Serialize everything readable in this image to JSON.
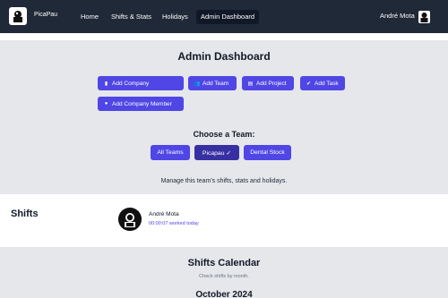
{
  "nav": {
    "brand": "PicaPau",
    "links": [
      {
        "label": "Home"
      },
      {
        "label": "Shifts & Stats"
      },
      {
        "label": "Holidays"
      },
      {
        "label": "Admin Dashboard"
      }
    ],
    "user_name": "André Mota"
  },
  "admin": {
    "title": "Admin Dashboard",
    "buttons": [
      {
        "label": "Add Company",
        "icon": "building-icon"
      },
      {
        "label": "Add Team",
        "icon": "team-icon"
      },
      {
        "label": "Add Project",
        "icon": "clipboard-icon"
      },
      {
        "label": "Add Task",
        "icon": "check-circle-icon"
      },
      {
        "label": "Add Company Member",
        "icon": "user-icon"
      }
    ]
  },
  "teams": {
    "title": "Choose a Team:",
    "options": [
      {
        "label": "All Teams"
      },
      {
        "label": "Picapau ✓"
      },
      {
        "label": "Dental Stock"
      }
    ],
    "selected": "Picapau",
    "manage_text": "Manage this team's shifts, stats and holidays."
  },
  "shifts": {
    "title": "Shifts",
    "entries": [
      {
        "name": "André Mota",
        "time": "00:00:07 worked today"
      }
    ]
  },
  "calendar": {
    "title": "Shifts Calendar",
    "subtitle": "Check shifts by month.",
    "month": "October 2024"
  },
  "colors": {
    "navbar": "#1f2937",
    "accent": "#4f46e5",
    "accent_selected": "#3730a3",
    "page_bg": "#e5e7eb"
  }
}
